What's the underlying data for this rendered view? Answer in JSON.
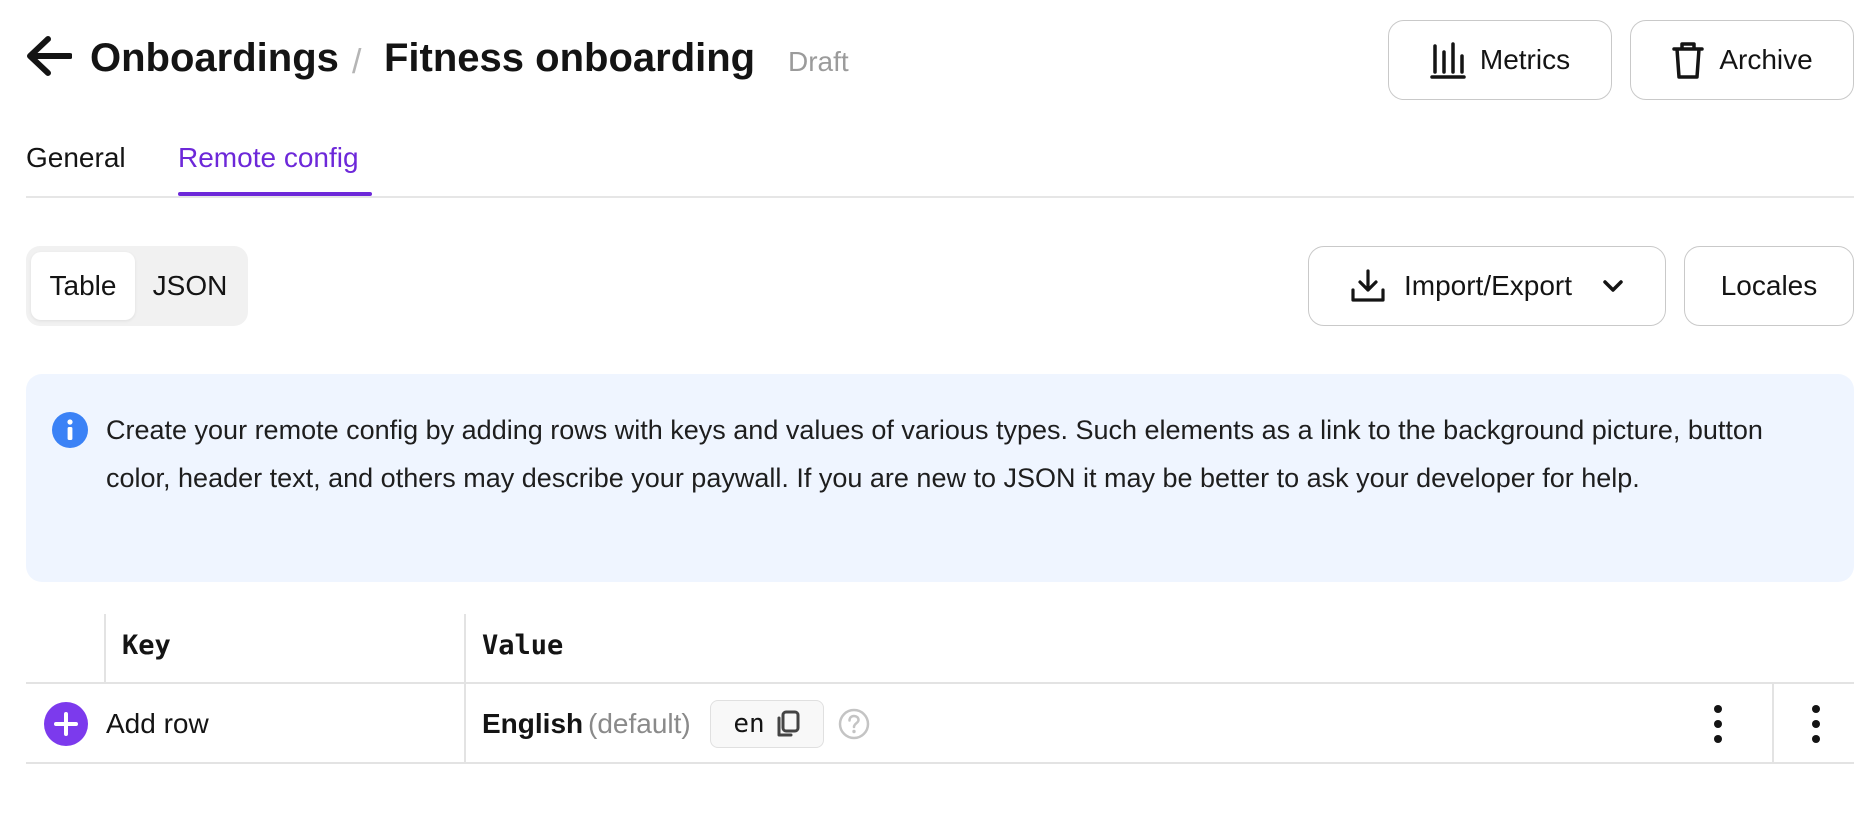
{
  "header": {
    "breadcrumb_root": "Onboardings",
    "breadcrumb_sep": "/",
    "title": "Fitness onboarding",
    "status": "Draft",
    "metrics_label": "Metrics",
    "archive_label": "Archive"
  },
  "tabs": [
    {
      "label": "General",
      "active": false
    },
    {
      "label": "Remote config",
      "active": true
    }
  ],
  "view_toggle": {
    "options": [
      "Table",
      "JSON"
    ],
    "selected": "Table"
  },
  "toolbar": {
    "import_export_label": "Import/Export",
    "locales_label": "Locales"
  },
  "info_banner": {
    "icon": "info-icon",
    "text": "Create your remote config by adding rows with keys and values of various types. Such elements as a link to the background picture, button color, header text, and others may describe your paywall. If you are new to JSON it may be better to ask your developer for help."
  },
  "table": {
    "headers": {
      "key": "Key",
      "value": "Value"
    },
    "add_row_label": "Add row",
    "locale": {
      "name": "English",
      "suffix": "(default)",
      "code": "en"
    }
  },
  "colors": {
    "accent": "#6d28d9",
    "add_button": "#7c3aed",
    "info_icon": "#3b82f6",
    "banner_bg": "#eff5ff",
    "muted_text": "#9b9b9b"
  }
}
